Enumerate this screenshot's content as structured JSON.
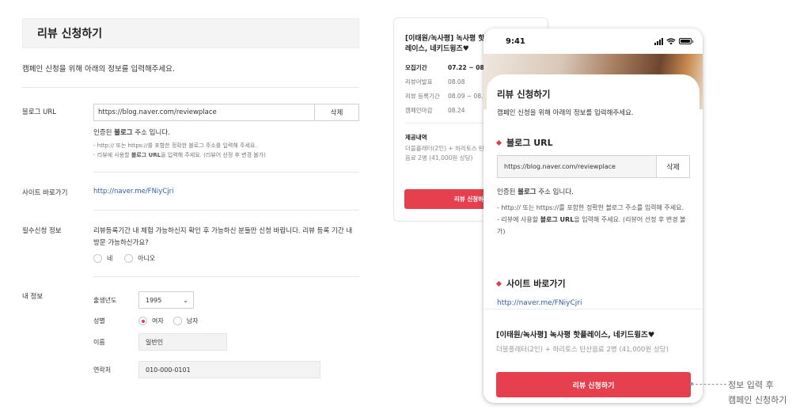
{
  "desktop": {
    "title": "리뷰 신청하기",
    "intro": "캠페인 신청을 위해 아래의 정보를 입력해주세요.",
    "blog_url": {
      "label": "블로그 URL",
      "value": "https://blog.naver.com/reviewplace",
      "delete_label": "삭제",
      "verified_pre": "인증된 ",
      "verified_bold": "블로그",
      "verified_post": " 주소 입니다.",
      "hint1": "- http:// 또는 https://를 포함한 정확한 블로그 주소를 입력해 주세요.",
      "hint2_pre": "- 리뷰에 사용할 ",
      "hint2_bold": "블로그 URL",
      "hint2_post": "을 입력해 주세요. (리뷰어 선정 후 변경 불가)"
    },
    "site": {
      "label": "사이트 바로가기",
      "link": "http://naver.me/FNiyCjri"
    },
    "required": {
      "label": "필수신청 정보",
      "question": "리뷰등록기간 내 체험 가능하신지 확인 후 가능하신 분들만 신청 바랍니다. 리뷰 등록 기간 내 방문 가능하신가요?",
      "yes": "네",
      "no": "아니오"
    },
    "my_info": {
      "label": "내 정보",
      "birth_label": "출생년도",
      "birth_value": "1995",
      "gender_label": "성별",
      "female": "여자",
      "male": "남자",
      "name_label": "이름",
      "name_value": "일반인",
      "phone_label": "연락처",
      "phone_value": "010-000-0101"
    }
  },
  "card": {
    "title": "[이태원/녹사평] 녹사평 핫플레이스, 네키드윙즈♥",
    "rows": [
      {
        "k": "모집기간",
        "v": "07.22 ~ 08.05"
      },
      {
        "k": "리뷰어발표",
        "v": "08.08"
      },
      {
        "k": "리뷰 등록기간",
        "v": "08.09 ~ 08.23"
      },
      {
        "k": "캠페인마감",
        "v": "08.24"
      }
    ],
    "offer_title": "제공내역",
    "offer": "더블플래터(2인) + 하리토스 탄산음료 2병 (41,000원 상당)",
    "button": "리뷰 신청하기"
  },
  "phone": {
    "time": "9:41",
    "sheet_title": "리뷰 신청하기",
    "intro": "캠페인 신청을 위해 아래의 정보를 입력해주세요.",
    "blog_head": "블로그 URL",
    "url_value": "https://blog.naver.com/reviewplace",
    "delete_label": "삭제",
    "verified_pre": "인증된 ",
    "verified_bold": "블로그",
    "verified_post": " 주소 입니다.",
    "hint1": "- http:// 또는 https://를 포함한 정확한 블로그 주소를 입력해 주세요.",
    "hint2_pre": "- 리뷰에 사용할 ",
    "hint2_bold": "블로그 URL",
    "hint2_post": "을 입력해 주세요. (리뷰어 선정 후 변경 불가)",
    "site_head": "사이트 바로가기",
    "site_link": "http://naver.me/FNiyCjri",
    "campaign_title": "[이태원/녹사평] 녹사평 핫플레이스, 네키드윙즈♥",
    "offer": "더블플래터(2인) + 하리토스 탄산음료 2병 (41,000원 상당)",
    "button": "리뷰 신청하기"
  },
  "annotation": {
    "line1": "정보 입력 후",
    "line2": "캠페인 신청하기"
  },
  "colors": {
    "accent": "#e6404f",
    "link": "#2e5f9e"
  }
}
